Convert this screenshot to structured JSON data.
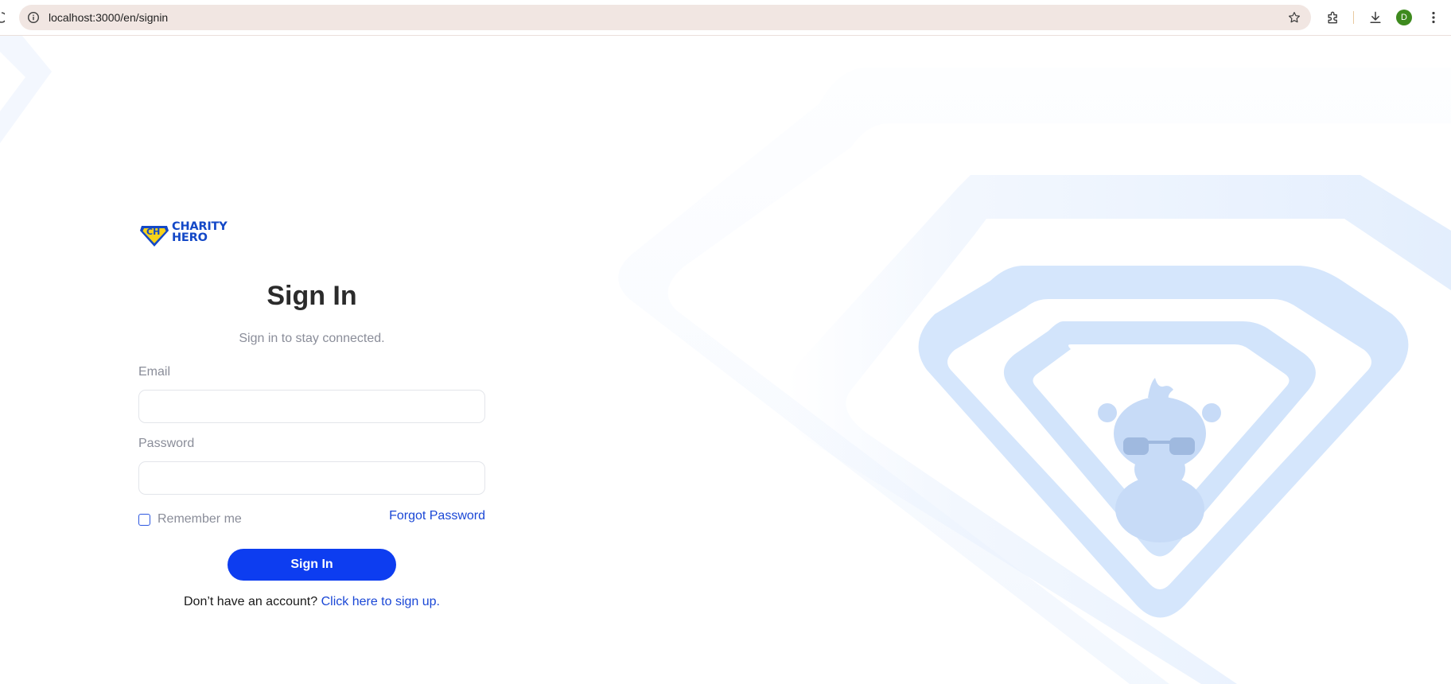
{
  "browser": {
    "url": "localhost:3000/en/signin",
    "avatar_letter": "D"
  },
  "brand": {
    "badge_letters": "CH",
    "name_line1": "CHARITY",
    "name_line2": "HERO",
    "colors": {
      "primary": "#1348c7",
      "badge_fill": "#f7d21a",
      "button": "#0d3df0",
      "link": "#1a47d6",
      "art": "#cfe2fb"
    }
  },
  "form": {
    "title": "Sign In",
    "subtitle": "Sign in to stay connected.",
    "email_label": "Email",
    "email_value": "",
    "password_label": "Password",
    "password_value": "",
    "remember_label": "Remember me",
    "remember_checked": false,
    "forgot_label": "Forgot Password",
    "submit_label": "Sign In",
    "signup_prompt": "Don’t have an account?",
    "signup_link": "Click here to sign up."
  },
  "icons": {
    "address_bar": "info-icon",
    "bookmark": "star-icon",
    "extensions": "puzzle-icon",
    "downloads": "download-icon",
    "menu": "kebab-menu-icon",
    "hero_art": "diamond-mascot-illustration"
  }
}
